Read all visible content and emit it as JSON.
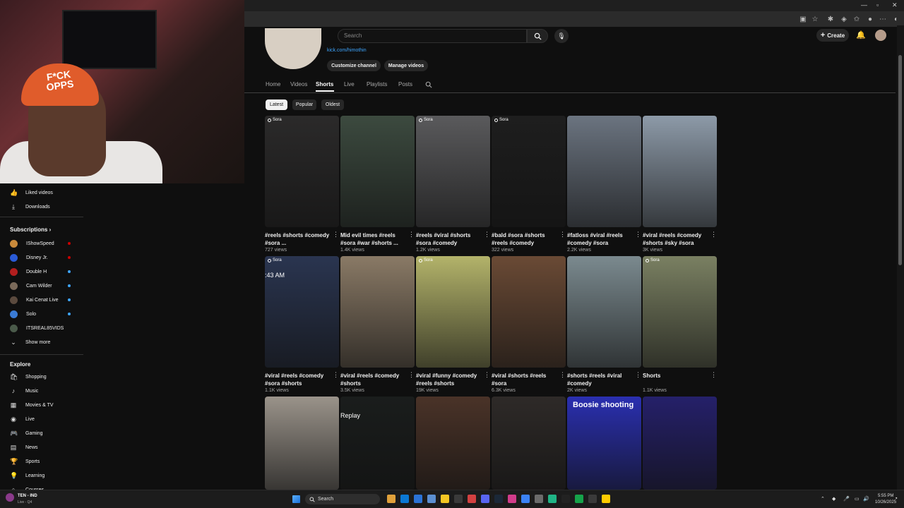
{
  "webcam": {
    "cap_text": "F*CK OPPS"
  },
  "browser": {
    "window_controls": [
      "—",
      "▫",
      "✕"
    ]
  },
  "header": {
    "search_placeholder": "Search",
    "create_label": "Create"
  },
  "channel": {
    "link": "kick.com/himothin",
    "customize_label": "Customize channel",
    "manage_label": "Manage videos"
  },
  "tabs": [
    "Home",
    "Videos",
    "Shorts",
    "Live",
    "Playlists",
    "Posts"
  ],
  "active_tab": "Shorts",
  "filters": [
    "Latest",
    "Popular",
    "Oldest"
  ],
  "active_filter": "Latest",
  "sora_label": "Sora",
  "shorts": [
    {
      "title": "#reels #shorts #comedy #sora ...",
      "views": "727 views",
      "sora": true,
      "color": "#2b2a2a"
    },
    {
      "title": "Mid evil times #reels #sora #war #shorts ...",
      "views": "1.4K views",
      "sora": false,
      "color": "#3c4a3f"
    },
    {
      "title": "#reels #viral #shorts #sora #comedy",
      "views": "1.2K views",
      "sora": true,
      "color": "#5a5a5c"
    },
    {
      "title": "#bald #sora #shorts #reels #comedy",
      "views": "322 views",
      "sora": true,
      "color": "#1e1e1e"
    },
    {
      "title": "#fatloss #viral #reels #comedy #sora",
      "views": "2.2K views",
      "sora": false,
      "color": "#6b7480"
    },
    {
      "title": "#viral #reels #comedy #shorts #sky #sora",
      "views": "3K views",
      "sora": false,
      "color": "#8d9aa8"
    },
    {
      "title": "#viral #reels #comedy #sora #shorts",
      "views": "1.1K views",
      "sora": true,
      "color": "#2a3550",
      "overlay": ":43 AM"
    },
    {
      "title": "#viral #reels #comedy #shorts",
      "views": "3.5K views",
      "sora": false,
      "color": "#8a7a66"
    },
    {
      "title": "#viral #funny #comedy #reels #shorts",
      "views": "19K views",
      "sora": true,
      "color": "#b3b36a"
    },
    {
      "title": "#viral #shorts #reels #sora",
      "views": "6.3K views",
      "sora": false,
      "color": "#6a4a35"
    },
    {
      "title": "#shorts #reels #viral #comedy",
      "views": "2K views",
      "sora": false,
      "color": "#7b8a8f"
    },
    {
      "title": "Shorts",
      "views": "1.1K views",
      "sora": true,
      "color": "#7a8062"
    },
    {
      "title": "",
      "views": "",
      "sora": false,
      "color": "#9a938a"
    },
    {
      "title": "",
      "views": "",
      "sora": false,
      "color": "#1a1d1c",
      "overlay": "Replay"
    },
    {
      "title": "",
      "views": "",
      "sora": false,
      "color": "#4a3328"
    },
    {
      "title": "",
      "views": "",
      "sora": false,
      "color": "#2e2a28"
    },
    {
      "title": "",
      "views": "",
      "sora": false,
      "color": "#2a2fb0",
      "big_overlay": "Boosie shooting"
    },
    {
      "title": "",
      "views": "",
      "sora": false,
      "color": "#25206a"
    }
  ],
  "sidebar": {
    "top_items": [
      {
        "label": "Liked videos",
        "icon": "like-icon",
        "glyph": "👍"
      },
      {
        "label": "Downloads",
        "icon": "download-icon",
        "glyph": "⤓"
      }
    ],
    "subscriptions_heading": "Subscriptions",
    "subscriptions": [
      {
        "label": "IShowSpeed",
        "color": "#c98a3b",
        "live": "#cc0000"
      },
      {
        "label": "Disney Jr.",
        "color": "#2a5bd7",
        "live": "#cc0000"
      },
      {
        "label": "Double H",
        "color": "#b21e1e",
        "live": "#3ea6ff"
      },
      {
        "label": "Cam Wilder",
        "color": "#7b6a5a",
        "live": "#3ea6ff"
      },
      {
        "label": "Kai Cenat Live",
        "color": "#5b4a3e",
        "live": "#3ea6ff"
      },
      {
        "label": "Solo",
        "color": "#3a7bd5",
        "live": "#3ea6ff"
      },
      {
        "label": "ITSREAL85VIDS",
        "color": "#4a5a4a",
        "live": ""
      }
    ],
    "show_more": "Show more",
    "explore_heading": "Explore",
    "explore": [
      {
        "label": "Shopping",
        "icon": "shopping-icon",
        "glyph": "🛍"
      },
      {
        "label": "Music",
        "icon": "music-icon",
        "glyph": "♪"
      },
      {
        "label": "Movies & TV",
        "icon": "movies-icon",
        "glyph": "▦"
      },
      {
        "label": "Live",
        "icon": "live-icon",
        "glyph": "◉"
      },
      {
        "label": "Gaming",
        "icon": "gaming-icon",
        "glyph": "🎮"
      },
      {
        "label": "News",
        "icon": "news-icon",
        "glyph": "▤"
      },
      {
        "label": "Sports",
        "icon": "sports-icon",
        "glyph": "🏆"
      },
      {
        "label": "Learning",
        "icon": "learning-icon",
        "glyph": "💡"
      },
      {
        "label": "Courses",
        "icon": "courses-icon",
        "glyph": "⌂"
      }
    ]
  },
  "taskbar": {
    "weather_title": "TEN - IND",
    "weather_sub": "Live - Q4",
    "search_label": "Search",
    "time": "5:55 PM",
    "date": "10/26/2025"
  }
}
